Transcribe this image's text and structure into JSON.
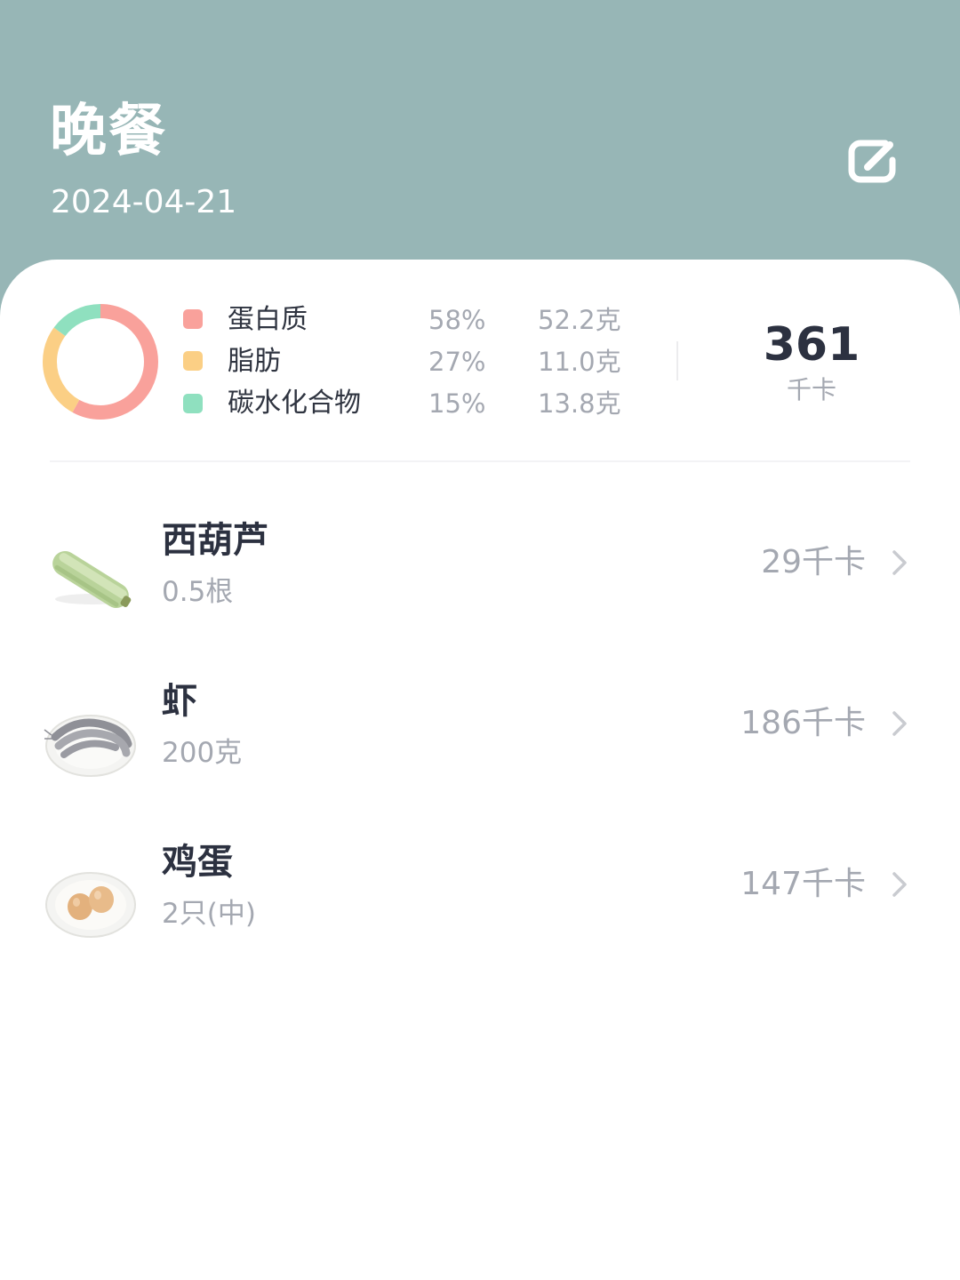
{
  "header": {
    "title": "晚餐",
    "date": "2024-04-21",
    "edit_icon": "edit-icon"
  },
  "summary": {
    "macros": [
      {
        "label": "蛋白质",
        "percent": "58%",
        "amount": "52.2克",
        "color": "#f9a19b",
        "share": 0.58
      },
      {
        "label": "脂肪",
        "percent": "27%",
        "amount": "11.0克",
        "color": "#fbcf85",
        "share": 0.27
      },
      {
        "label": "碳水化合物",
        "percent": "15%",
        "amount": "13.8克",
        "color": "#8fe0bf",
        "share": 0.15
      }
    ],
    "total_value": "361",
    "total_unit": "千卡"
  },
  "foods": [
    {
      "name": "西葫芦",
      "quantity": "0.5根",
      "calories": "29千卡",
      "image_icon": "zucchini-image"
    },
    {
      "name": "虾",
      "quantity": "200克",
      "calories": "186千卡",
      "image_icon": "shrimp-image"
    },
    {
      "name": "鸡蛋",
      "quantity": "2只(中)",
      "calories": "147千卡",
      "image_icon": "eggs-image"
    }
  ],
  "colors": {
    "header_bg": "#97b6b6",
    "card_bg": "#ffffff",
    "primary_text": "#2c3140",
    "secondary_text": "#a4a8b1"
  }
}
